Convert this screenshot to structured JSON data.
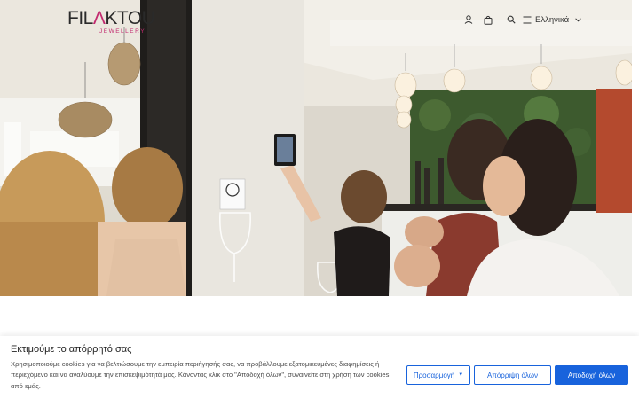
{
  "header": {
    "logo": {
      "main_dark": "FIL",
      "main_pink": "Λ",
      "main_rest": "KTOU",
      "sub": "JEWELLERY"
    },
    "icons": [
      "user-icon",
      "shopping-bag-icon",
      "search-icon",
      "menu-icon"
    ],
    "language": {
      "label": "Ελληνικά"
    }
  },
  "hero": {
    "image": "group-of-women-taking-selfie-at-restaurant"
  },
  "cookie_banner": {
    "title": "Εκτιμούμε το απόρρητό σας",
    "text": "Χρησιμοποιούμε cookies για να βελτιώσουμε την εμπειρία περιήγησής σας, να προβάλλουμε εξατομικευμένες διαφημίσεις ή περιεχόμενο και να αναλύουμε την επισκεψιμότητά μας. Κάνοντας κλικ στο \"Αποδοχή όλων\", συναινείτε στη χρήση των cookies από εμάς.",
    "buttons": {
      "customize": "Προσαρμογή",
      "reject": "Απόρριψη όλων",
      "accept": "Αποδοχή όλων"
    }
  },
  "colors": {
    "brand_pink": "#c22a6f",
    "accent_blue": "#1863dc"
  }
}
